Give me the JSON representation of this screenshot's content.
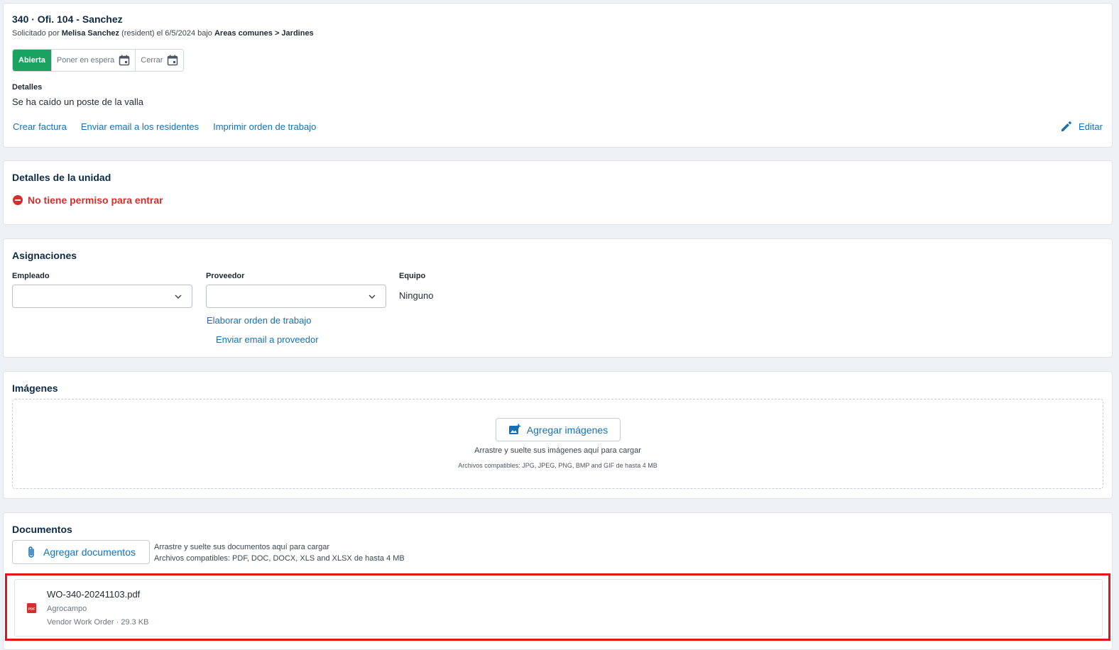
{
  "request": {
    "title": "340 · Ofi. 104 - Sanchez",
    "subtitle_prefix": "Solicitado por ",
    "requester": "Melisa Sanchez",
    "subtitle_mid": " (resident) el 6/5/2024 bajo ",
    "category": "Areas comunes > Jardines",
    "status_buttons": {
      "open": "Abierta",
      "hold": "Poner en espera",
      "close": "Cerrar"
    },
    "details_label": "Detalles",
    "details_text": "Se ha caído un poste de la valla",
    "actions": {
      "create_invoice": "Crear factura",
      "email_residents": "Enviar email a los residentes",
      "print_work_order": "Imprimir orden de trabajo",
      "edit": "Editar"
    }
  },
  "unit": {
    "title": "Detalles de la unidad",
    "entry_status": "No tiene permiso para entrar"
  },
  "assignments": {
    "title": "Asignaciones",
    "employee_label": "Empleado",
    "employee_value": "",
    "vendor_label": "Proveedor",
    "vendor_value": "",
    "equipment_label": "Equipo",
    "equipment_value": "Ninguno",
    "create_work_order": "Elaborar orden de trabajo",
    "email_vendor": "Enviar email a proveedor"
  },
  "images": {
    "title": "Imágenes",
    "add_button": "Agregar imágenes",
    "drop_text": "Arrastre y suelte sus imágenes aquí para cargar",
    "supported": "Archivos compatibles: JPG, JPEG, PNG, BMP and GIF de hasta 4 MB"
  },
  "documents": {
    "title": "Documentos",
    "add_button": "Agregar documentos",
    "drop_text": "Arrastre y suelte sus documentos aquí para cargar",
    "supported": "Archivos compatibles: PDF, DOC, DOCX, XLS and XLSX de hasta 4 MB",
    "items": [
      {
        "name": "WO-340-20241103.pdf",
        "vendor": "Agrocampo",
        "meta": "Vendor Work Order · 29.3 KB",
        "icon_text": "PDF"
      }
    ]
  },
  "colors": {
    "accent": "#1570b5",
    "status_open": "#1aa260",
    "error": "#d32f2f",
    "highlight": "#e3151a"
  }
}
